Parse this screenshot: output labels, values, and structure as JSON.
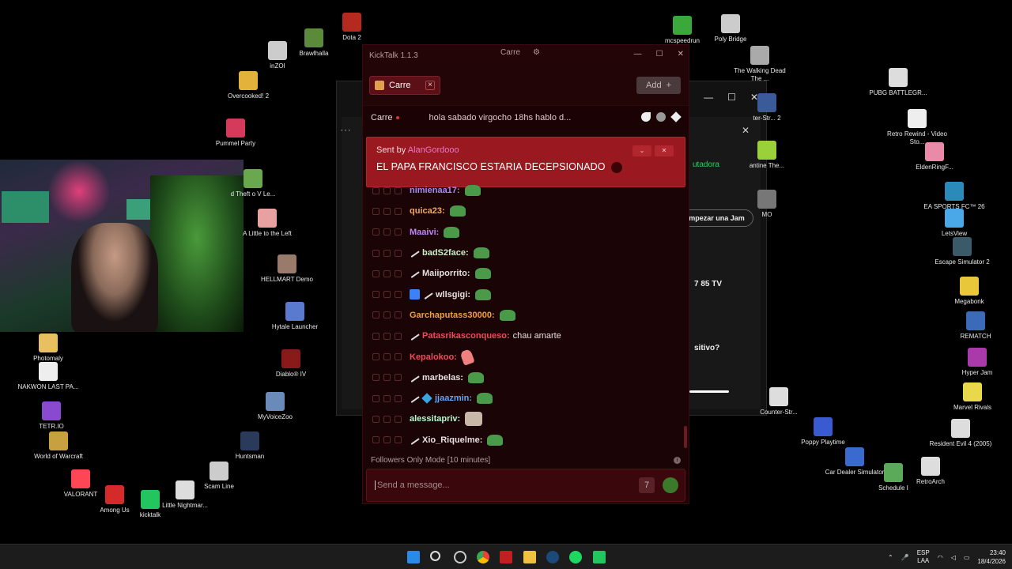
{
  "desktop_icons": [
    {
      "label": "Dota 2",
      "color": "#b52a1e"
    },
    {
      "label": "Brawlhalla",
      "color": "#5a8a3a"
    },
    {
      "label": "inZOI",
      "color": "#cccccc"
    },
    {
      "label": "Overcooked! 2",
      "color": "#e2b23a"
    },
    {
      "label": "Pummel Party",
      "color": "#d63a5a"
    },
    {
      "label": "d Theft o V Le...",
      "color": "#6aa84f"
    },
    {
      "label": "A Little to the Left",
      "color": "#e8a0a0"
    },
    {
      "label": "HELLMART Demo",
      "color": "#9a7a6a"
    },
    {
      "label": "Hytale Launcher",
      "color": "#5a7ad0"
    },
    {
      "label": "Diablo® IV",
      "color": "#8a1a1a"
    },
    {
      "label": "MyVoiceZoo",
      "color": "#6a8aba"
    },
    {
      "label": "Huntsman",
      "color": "#2a3a5a"
    },
    {
      "label": "Scam Line",
      "color": "#cccccc"
    },
    {
      "label": "Little Nightmar...",
      "color": "#dddddd"
    },
    {
      "label": "kicktalk",
      "color": "#22c55e"
    },
    {
      "label": "Among Us",
      "color": "#d62a2a"
    },
    {
      "label": "VALORANT",
      "color": "#ff4655"
    },
    {
      "label": "World of Warcraft",
      "color": "#c8a040"
    },
    {
      "label": "TETR.IO",
      "color": "#8a4ad0"
    },
    {
      "label": "NAKWON LAST PA...",
      "color": "#eeeeee"
    },
    {
      "label": "Photomaly",
      "color": "#e8c060"
    },
    {
      "label": "mcspeedrun",
      "color": "#3aa83a"
    },
    {
      "label": "Poly Bridge",
      "color": "#cccccc"
    },
    {
      "label": "The Walking Dead The ...",
      "color": "#aaaaaa"
    },
    {
      "label": "PUBG BATTLEGR...",
      "color": "#dddddd"
    },
    {
      "label": "Retro Rewind - Video Sto...",
      "color": "#eeeeee"
    },
    {
      "label": "EldenRingF...",
      "color": "#e88aa8"
    },
    {
      "label": "EA SPORTS FC™ 26",
      "color": "#2a8aba"
    },
    {
      "label": "LetsView",
      "color": "#4aa8e8"
    },
    {
      "label": "Escape Simulator 2",
      "color": "#3a5a6a"
    },
    {
      "label": "Megabonk",
      "color": "#e8c83a"
    },
    {
      "label": "REMATCH",
      "color": "#3a6ab8"
    },
    {
      "label": "Hyper Jam",
      "color": "#aa3aaa"
    },
    {
      "label": "Marvel Rivals",
      "color": "#e8d84a"
    },
    {
      "label": "Resident Evil 4 (2005)",
      "color": "#dddddd"
    },
    {
      "label": "RetroArch",
      "color": "#dddddd"
    },
    {
      "label": "Schedule I",
      "color": "#5aaa5a"
    },
    {
      "label": "Car Dealer Simulator",
      "color": "#3a6ad0"
    },
    {
      "label": "Poppy Playtime",
      "color": "#3a5ad0"
    },
    {
      "label": "Counter-Str...",
      "color": "#dddddd"
    },
    {
      "label": "ter-Str... 2",
      "color": "#3a5a9a"
    },
    {
      "label": "antine The...",
      "color": "#9ad03a"
    },
    {
      "label": "MO",
      "color": "#777777"
    }
  ],
  "background_window": {
    "item_label": "utadora",
    "jam_button": "mpezar una Jam",
    "device": "7 85 TV",
    "question": "sitivo?"
  },
  "kicktalk": {
    "title": "KickTalk 1.1.3",
    "center_label": "Carre",
    "tab_label": "Carre",
    "add_label": "Add",
    "channel_name": "Carre",
    "ticker": "hola  sabado virgocho  18hs hablo d...",
    "pinned": {
      "sent_by_prefix": "Sent by",
      "sent_by_user": "AlanGordooo",
      "message": "EL PAPA FRANCISCO ESTARIA DECEPSIONADO"
    },
    "messages": [
      {
        "user": "nimienaa17:",
        "color": "#a78bfa",
        "badges": [],
        "emote": "green",
        "text": ""
      },
      {
        "user": "quica23:",
        "color": "#f0a860",
        "badges": [],
        "emote": "green",
        "text": ""
      },
      {
        "user": "Maaivi:",
        "color": "#c084fc",
        "badges": [],
        "emote": "green",
        "text": ""
      },
      {
        "user": "badS2face:",
        "color": "#c8f0c8",
        "badges": [
          "sword"
        ],
        "emote": "green",
        "text": ""
      },
      {
        "user": "Maiiporrito:",
        "color": "#e8e0e0",
        "badges": [
          "sword"
        ],
        "emote": "green",
        "text": ""
      },
      {
        "user": "wllsgigi:",
        "color": "#e8e0e0",
        "badges": [
          "blue",
          "sword"
        ],
        "emote": "green",
        "text": ""
      },
      {
        "user": "Garchaputass30000:",
        "color": "#f0a040",
        "badges": [],
        "emote": "green",
        "text": ""
      },
      {
        "user": "Patasrikasconqueso:",
        "color": "#f24a5a",
        "badges": [
          "sword"
        ],
        "emote": "",
        "text": "chau amarte"
      },
      {
        "user": "Kepalokoo:",
        "color": "#f24a5a",
        "badges": [],
        "emote": "pink",
        "text": ""
      },
      {
        "user": "marbelas:",
        "color": "#e8e0e0",
        "badges": [
          "sword"
        ],
        "emote": "green",
        "text": ""
      },
      {
        "user": "jjaazmin:",
        "color": "#60a5fa",
        "badges": [
          "sword",
          "cube"
        ],
        "emote": "green",
        "text": ""
      },
      {
        "user": "alessitapriv:",
        "color": "#bbf7d0",
        "badges": [],
        "emote": "cat",
        "text": ""
      },
      {
        "user": "Xio_Riquelme:",
        "color": "#e8e0e0",
        "badges": [
          "sword"
        ],
        "emote": "green",
        "text": ""
      }
    ],
    "followers_mode": "Followers Only Mode [10 minutes]",
    "composer_placeholder": "Send a message..."
  },
  "taskbar": {
    "lang_top": "ESP",
    "lang_bottom": "LAA",
    "time": "23:40",
    "date": "18/4/2026"
  }
}
